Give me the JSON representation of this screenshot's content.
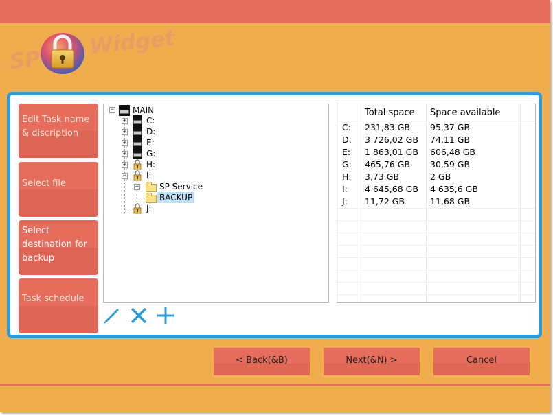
{
  "header": {
    "logo_sp": "SP",
    "logo_widget": "Widget"
  },
  "steps": [
    {
      "label": "Edit Task name & discription"
    },
    {
      "label": "Select file"
    },
    {
      "label": "Select destination for backup"
    },
    {
      "label": "Task schedule"
    }
  ],
  "tree": {
    "root": "MAIN",
    "items": [
      "C:",
      "D:",
      "E:",
      "G:",
      "H:",
      "I:",
      "SP Service",
      "BACKUP",
      "J:"
    ]
  },
  "drives": {
    "columns": [
      "Total space",
      "Space available"
    ],
    "rows": [
      {
        "drive": "C:",
        "total": "231,83 GB",
        "available": "95,37 GB"
      },
      {
        "drive": "D:",
        "total": "3 726,02 GB",
        "available": "74,11 GB"
      },
      {
        "drive": "E:",
        "total": "1 863,01 GB",
        "available": "606,48 GB"
      },
      {
        "drive": "G:",
        "total": "465,76 GB",
        "available": "30,59 GB"
      },
      {
        "drive": "H:",
        "total": "3,73 GB",
        "available": "2 GB"
      },
      {
        "drive": "I:",
        "total": "4 645,68 GB",
        "available": "4 635,6 GB"
      },
      {
        "drive": "J:",
        "total": "11,72 GB",
        "available": "11,68 GB"
      }
    ]
  },
  "toolbar": {
    "edit_icon": "pencil-icon",
    "delete_icon": "close-icon",
    "add_icon": "plus-icon"
  },
  "buttons": {
    "back": "< Back(&B)",
    "next": "Next(&N) >",
    "cancel": "Cancel"
  },
  "colors": {
    "accent_blue": "#2f9bd5",
    "coral": "#e66c5c",
    "orange": "#f0ad4e"
  }
}
